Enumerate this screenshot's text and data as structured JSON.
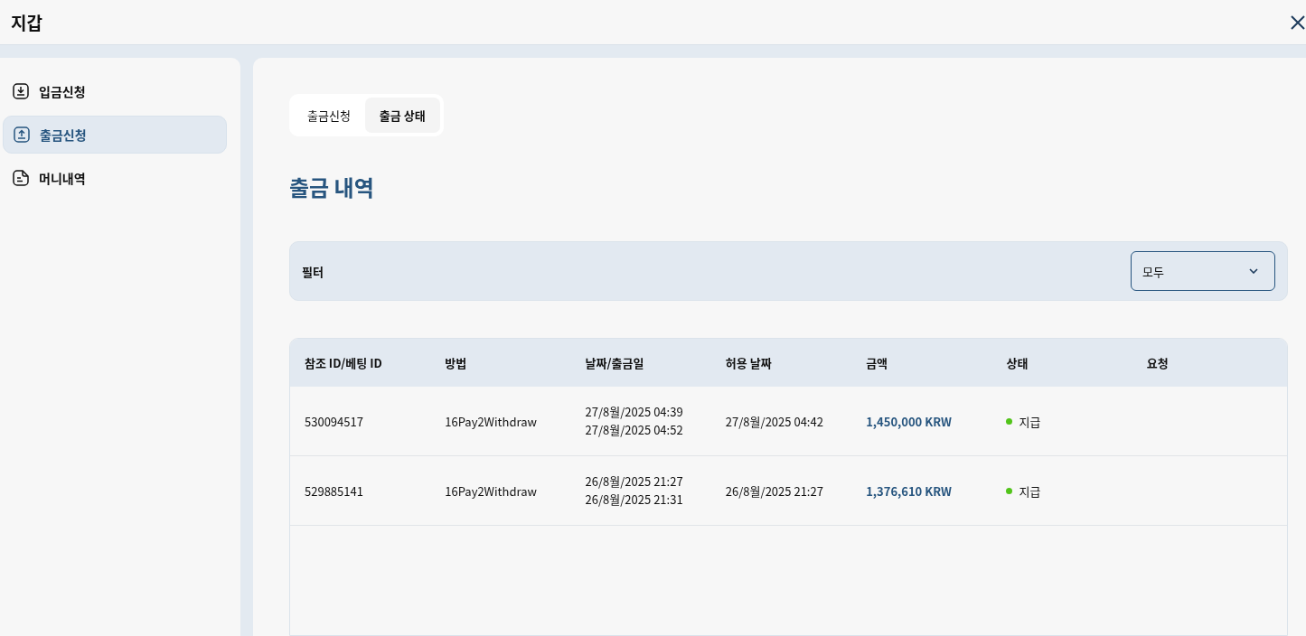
{
  "window": {
    "title": "지갑"
  },
  "sidebar": {
    "items": [
      {
        "label": "입금신청",
        "selected": false
      },
      {
        "label": "출금신청",
        "selected": true
      },
      {
        "label": "머니내역",
        "selected": false
      }
    ]
  },
  "tabs": [
    {
      "label": "출금신청",
      "selected": false
    },
    {
      "label": "출금 상태",
      "selected": true
    }
  ],
  "heading": "출금 내역",
  "filter": {
    "label": "필터",
    "value": "모두"
  },
  "table": {
    "columns": [
      "참조 ID/베팅 ID",
      "방법",
      "날짜/출금일",
      "허용 날짜",
      "금액",
      "상태",
      "요청"
    ],
    "rows": [
      {
        "ref": "530094517",
        "method": "16Pay2Withdraw",
        "dates": [
          "27/8월/2025 04:39",
          "27/8월/2025 04:52"
        ],
        "approved": "27/8월/2025 04:42",
        "amount": "1,450,000 KRW",
        "status": {
          "label": "지급",
          "color": "#52c41a"
        }
      },
      {
        "ref": "529885141",
        "method": "16Pay2Withdraw",
        "dates": [
          "26/8월/2025 21:27",
          "26/8월/2025 21:31"
        ],
        "approved": "26/8월/2025 21:27",
        "amount": "1,376,610 KRW",
        "status": {
          "label": "지급",
          "color": "#52c41a"
        }
      }
    ]
  }
}
